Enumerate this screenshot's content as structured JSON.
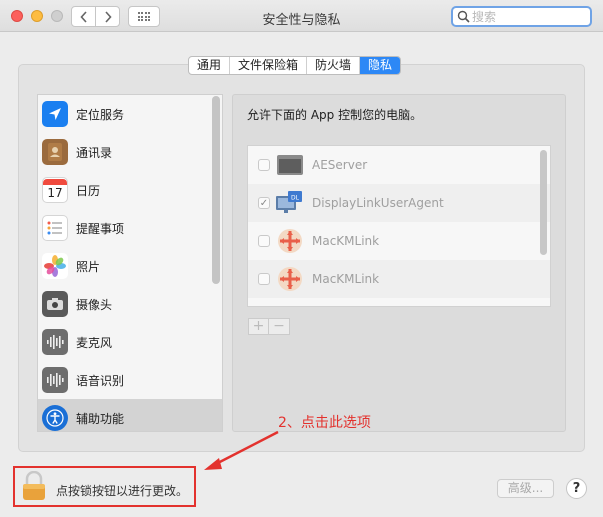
{
  "window": {
    "title": "安全性与隐私",
    "search_placeholder": "搜索"
  },
  "tabs": [
    {
      "label": "通用",
      "active": false
    },
    {
      "label": "文件保险箱",
      "active": false
    },
    {
      "label": "防火墙",
      "active": false
    },
    {
      "label": "隐私",
      "active": true
    }
  ],
  "sidebar": {
    "items": [
      {
        "label": "定位服务",
        "icon": "location-arrow-icon"
      },
      {
        "label": "通讯录",
        "icon": "contacts-book-icon"
      },
      {
        "label": "日历",
        "icon": "calendar-icon",
        "day": "17"
      },
      {
        "label": "提醒事项",
        "icon": "reminders-icon"
      },
      {
        "label": "照片",
        "icon": "photos-icon"
      },
      {
        "label": "摄像头",
        "icon": "camera-icon"
      },
      {
        "label": "麦克风",
        "icon": "microphone-icon"
      },
      {
        "label": "语音识别",
        "icon": "speech-recognition-icon"
      },
      {
        "label": "辅助功能",
        "icon": "accessibility-icon",
        "selected": true
      }
    ]
  },
  "main": {
    "title": "允许下面的 App 控制您的电脑。",
    "apps": [
      {
        "name": "AEServer",
        "checked": false,
        "icon": "generic-app-icon"
      },
      {
        "name": "DisplayLinkUserAgent",
        "checked": true,
        "icon": "displaylink-icon",
        "badge": "DL"
      },
      {
        "name": "MacKMLink",
        "checked": false,
        "icon": "mackmlink-icon"
      },
      {
        "name": "MacKMLink",
        "checked": false,
        "icon": "mackmlink-icon"
      }
    ],
    "add_label": "+",
    "remove_label": "−"
  },
  "annotation": {
    "text": "2、点击此选项",
    "color": "#e3322e"
  },
  "footer": {
    "lock_label": "点按锁按钮以进行更改。",
    "advanced_label": "高级...",
    "help_label": "?"
  }
}
